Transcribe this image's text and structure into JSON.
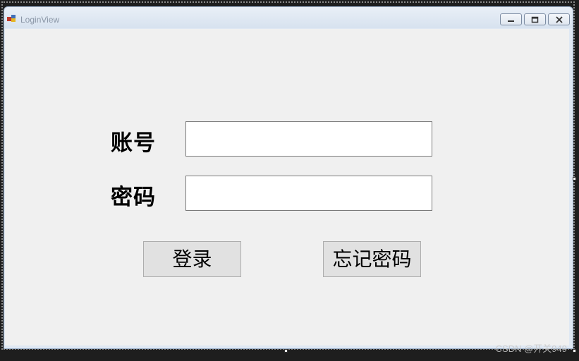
{
  "window": {
    "title": "LoginView"
  },
  "form": {
    "account_label": "账号",
    "account_value": "",
    "password_label": "密码",
    "password_value": "",
    "login_button": "登录",
    "forgot_button": "忘记密码"
  },
  "watermark": "CSDN @开关949"
}
